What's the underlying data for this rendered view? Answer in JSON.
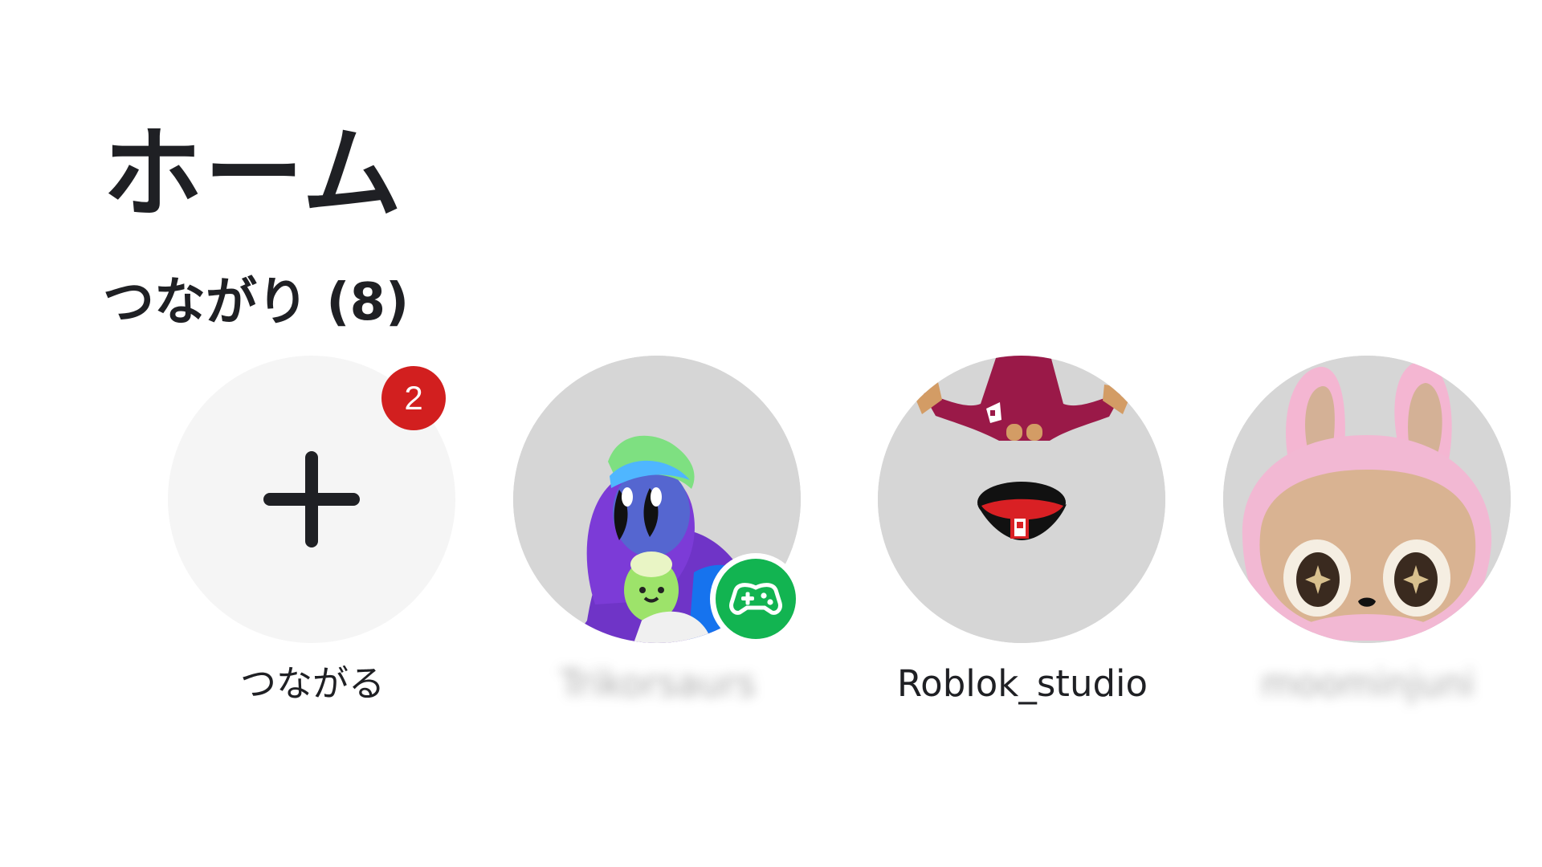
{
  "header": {
    "title": "ホーム"
  },
  "connections": {
    "title": "つながり (8)",
    "add_label": "つながる",
    "add_badge_count": "2",
    "items": [
      {
        "name": "Trikorsaurs",
        "status": "playing"
      },
      {
        "name": "Roblok_studio",
        "status": "online"
      },
      {
        "name": "moominjuni",
        "status": "online"
      }
    ]
  },
  "colors": {
    "text": "#1f2024",
    "avatar_background": "#d6d6d6",
    "add_background": "#f5f5f5",
    "notification_badge": "#d21f1f",
    "game_status": "#12b451"
  },
  "icons": {
    "add": "plus-icon",
    "game_status": "gamepad-icon"
  }
}
